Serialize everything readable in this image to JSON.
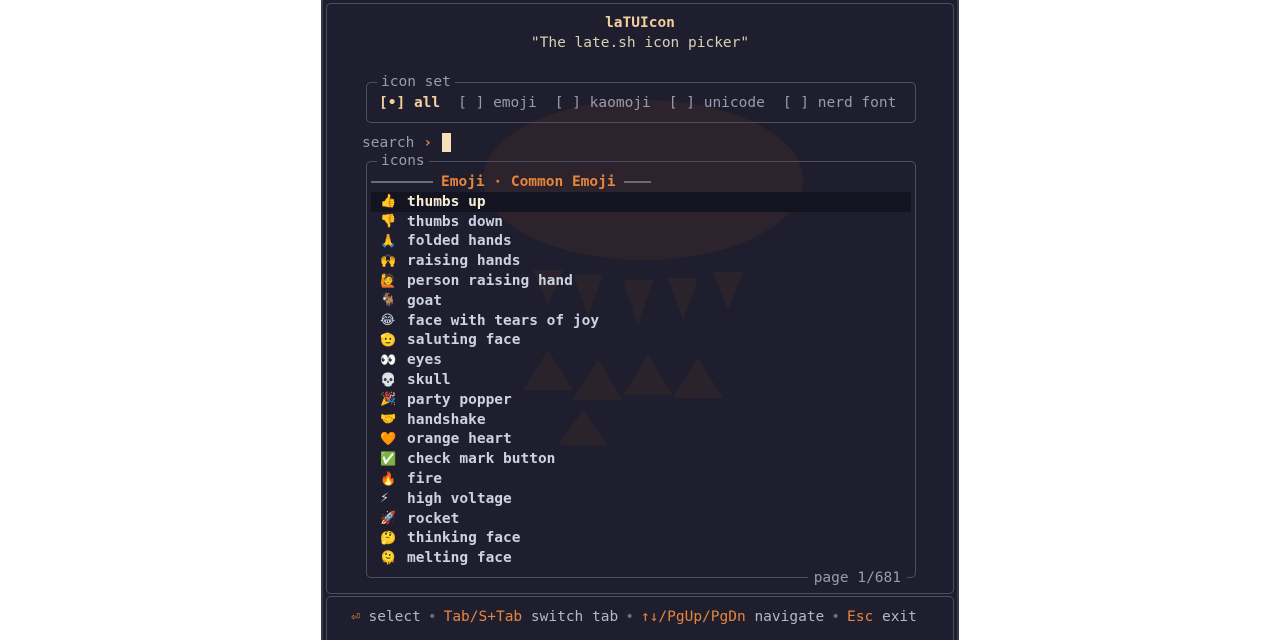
{
  "header": {
    "title": "laTUIcon",
    "subtitle": "\"The late.sh icon picker\""
  },
  "icon_set": {
    "label": "icon set",
    "options": [
      {
        "marker": "[•]",
        "label": "all",
        "selected": true
      },
      {
        "marker": "[ ]",
        "label": "emoji",
        "selected": false
      },
      {
        "marker": "[ ]",
        "label": "kaomoji",
        "selected": false
      },
      {
        "marker": "[ ]",
        "label": "unicode",
        "selected": false
      },
      {
        "marker": "[ ]",
        "label": "nerd font",
        "selected": false
      }
    ]
  },
  "search": {
    "label": "search",
    "arrow": "›",
    "value": ""
  },
  "icons": {
    "label": "icons",
    "category": "Emoji · Common Emoji",
    "items": [
      {
        "emoji": "👍",
        "name": "thumbs up"
      },
      {
        "emoji": "👎",
        "name": "thumbs down"
      },
      {
        "emoji": "🙏",
        "name": "folded hands"
      },
      {
        "emoji": "🙌",
        "name": "raising hands"
      },
      {
        "emoji": "🙋",
        "name": "person raising hand"
      },
      {
        "emoji": "🐐",
        "name": "goat"
      },
      {
        "emoji": "😂",
        "name": "face with tears of joy"
      },
      {
        "emoji": "🫡",
        "name": "saluting face"
      },
      {
        "emoji": "👀",
        "name": "eyes"
      },
      {
        "emoji": "💀",
        "name": "skull"
      },
      {
        "emoji": "🎉",
        "name": "party popper"
      },
      {
        "emoji": "🤝",
        "name": "handshake"
      },
      {
        "emoji": "🧡",
        "name": "orange heart"
      },
      {
        "emoji": "✅",
        "name": "check mark button"
      },
      {
        "emoji": "🔥",
        "name": "fire"
      },
      {
        "emoji": "⚡",
        "name": "high voltage"
      },
      {
        "emoji": "🚀",
        "name": "rocket"
      },
      {
        "emoji": "🤔",
        "name": "thinking face"
      },
      {
        "emoji": "🫠",
        "name": "melting face"
      }
    ],
    "page": "page 1/681"
  },
  "footer": {
    "select_key": "⏎",
    "select_label": "select",
    "tab_key": "Tab/S+Tab",
    "tab_label": "switch tab",
    "nav_key": "↑↓/PgUp/PgDn",
    "nav_label": "navigate",
    "exit_key": "Esc",
    "exit_label": "exit",
    "separator": "•"
  },
  "colors": {
    "background": "#1e1e2e",
    "accent": "#e8853a",
    "title": "#f2cf9c",
    "text": "#cdd2e0",
    "muted": "#9a9aac",
    "border": "#4e4e5e"
  }
}
